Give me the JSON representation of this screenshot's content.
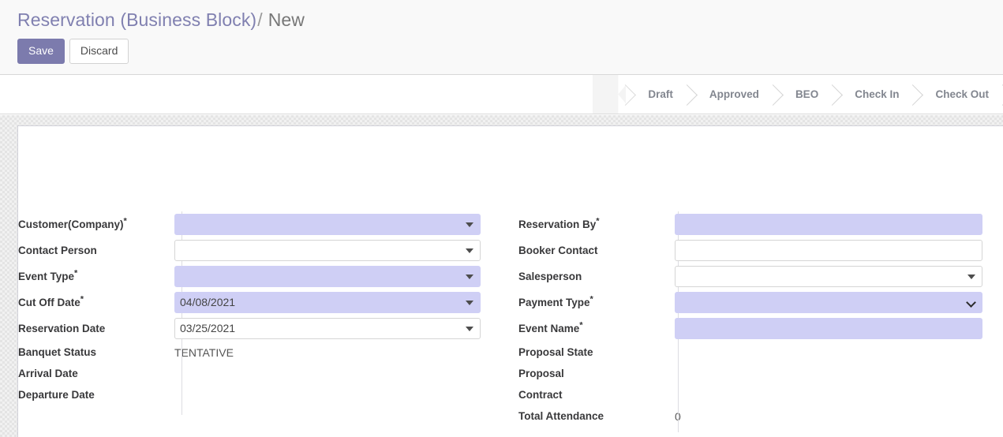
{
  "header": {
    "breadcrumb_parent": "Reservation (Business Block)",
    "breadcrumb_separator": "/",
    "breadcrumb_current": "New",
    "save_label": "Save",
    "discard_label": "Discard",
    "accent_color": "#7c7bad"
  },
  "statusbar": {
    "stages": [
      {
        "label": "Draft"
      },
      {
        "label": "Approved"
      },
      {
        "label": "BEO"
      },
      {
        "label": "Check In"
      },
      {
        "label": "Check Out"
      }
    ]
  },
  "form": {
    "required_marker": "*",
    "required_field_color": "#cfcff5",
    "left_column": [
      {
        "label": "Customer(Company)",
        "required": true,
        "type": "dropdown",
        "value": "",
        "highlighted": true,
        "caret": "triangle-down-icon"
      },
      {
        "label": "Contact Person",
        "required": false,
        "type": "dropdown",
        "value": "",
        "highlighted": false,
        "caret": "triangle-down-icon"
      },
      {
        "label": "Event Type",
        "required": true,
        "type": "dropdown",
        "value": "",
        "highlighted": true,
        "caret": "triangle-down-icon"
      },
      {
        "label": "Cut Off Date",
        "required": true,
        "type": "date",
        "value": "04/08/2021",
        "highlighted": true,
        "caret": "triangle-down-icon"
      },
      {
        "label": "Reservation Date",
        "required": false,
        "type": "date",
        "value": "03/25/2021",
        "highlighted": false,
        "caret": "triangle-down-icon"
      }
    ],
    "left_readonly": [
      {
        "label": "Banquet Status",
        "value": "TENTATIVE"
      },
      {
        "label": "Arrival Date",
        "value": ""
      },
      {
        "label": "Departure Date",
        "value": ""
      }
    ],
    "right_column": [
      {
        "label": "Reservation By",
        "required": true,
        "type": "text",
        "value": "",
        "highlighted": true,
        "caret": "none"
      },
      {
        "label": "Booker Contact",
        "required": false,
        "type": "text",
        "value": "",
        "highlighted": false,
        "caret": "none"
      },
      {
        "label": "Salesperson",
        "required": false,
        "type": "dropdown",
        "value": "",
        "highlighted": false,
        "caret": "triangle-down-icon"
      },
      {
        "label": "Payment Type",
        "required": true,
        "type": "select",
        "value": "",
        "highlighted": true,
        "caret": "chevron-down-icon"
      },
      {
        "label": "Event Name",
        "required": true,
        "type": "text",
        "value": "",
        "highlighted": true,
        "caret": "none"
      }
    ],
    "right_readonly": [
      {
        "label": "Proposal State",
        "value": ""
      },
      {
        "label": "Proposal",
        "value": ""
      },
      {
        "label": "Contract",
        "value": ""
      },
      {
        "label": "Total Attendance",
        "value": "0"
      }
    ]
  }
}
